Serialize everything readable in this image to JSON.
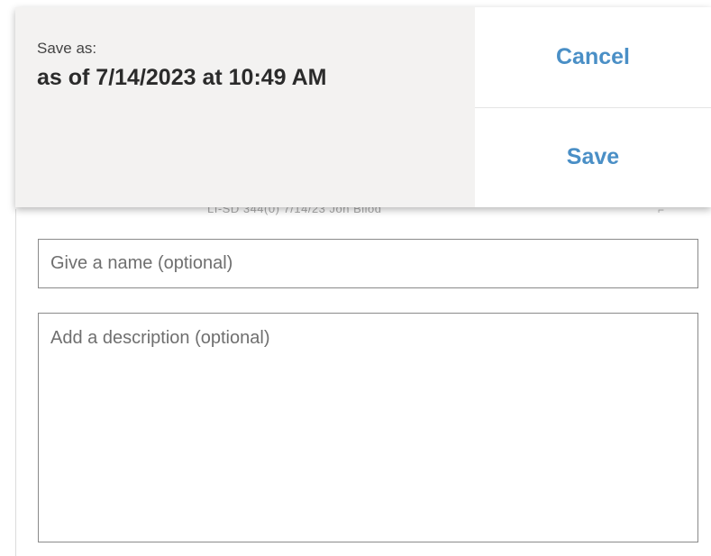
{
  "dialog": {
    "save_as_label": "Save as:",
    "save_as_value": "as of 7/14/2023 at 10:49 AM",
    "cancel_label": "Cancel",
    "save_label": "Save"
  },
  "background": {
    "partial_row_text": "LI-SD 344(0) 7/14/23  Jon Bilod"
  },
  "form": {
    "name_placeholder": "Give a name (optional)",
    "name_value": "",
    "description_placeholder": "Add a description (optional)",
    "description_value": ""
  },
  "colors": {
    "accent": "#4a8fc6",
    "dialog_left_bg": "#f3f2f1"
  }
}
